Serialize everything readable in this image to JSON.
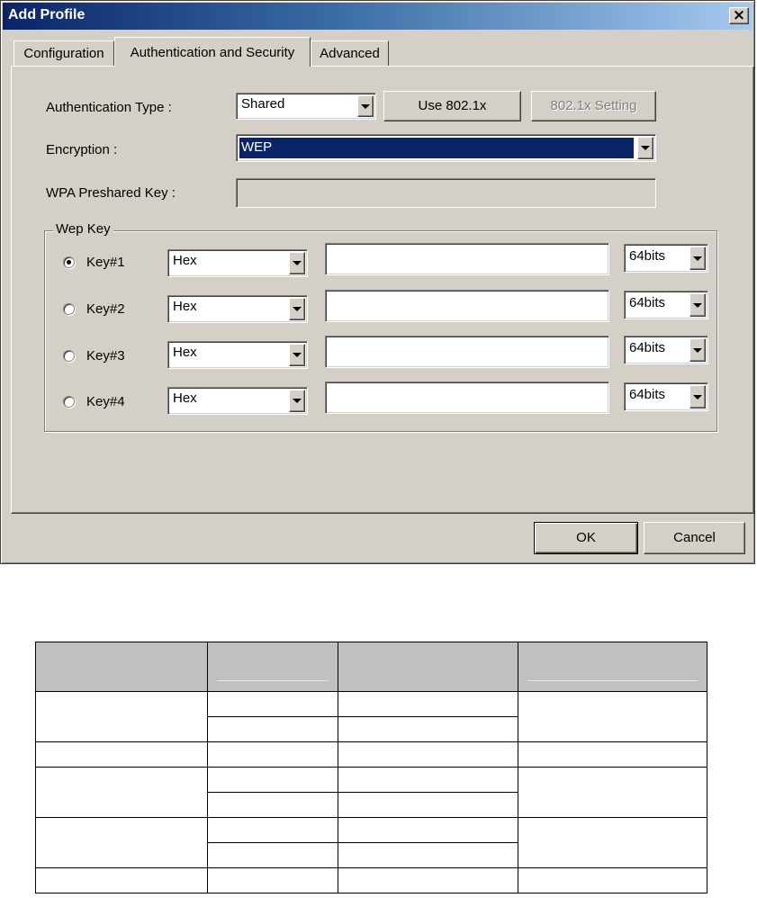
{
  "window": {
    "title": "Add Profile",
    "close_label": "×"
  },
  "tabs": [
    {
      "label": "Configuration",
      "active": false
    },
    {
      "label": "Authentication and Security",
      "active": true
    },
    {
      "label": "Advanced",
      "active": false
    }
  ],
  "auth": {
    "type_label": "Authentication Type :",
    "type_value": "Shared",
    "use_8021x_label": "Use 802.1x",
    "setting_8021x_label": "802.1x Setting",
    "encryption_label": "Encryption :",
    "encryption_value": "WEP",
    "wpa_label": "WPA Preshared Key :",
    "wpa_value": ""
  },
  "wep": {
    "group_label": "Wep Key",
    "keys": [
      {
        "label": "Key#1",
        "selected": true,
        "format": "Hex",
        "value": "",
        "length": "64bits"
      },
      {
        "label": "Key#2",
        "selected": false,
        "format": "Hex",
        "value": "",
        "length": "64bits"
      },
      {
        "label": "Key#3",
        "selected": false,
        "format": "Hex",
        "value": "",
        "length": "64bits"
      },
      {
        "label": "Key#4",
        "selected": false,
        "format": "Hex",
        "value": "",
        "length": "64bits"
      }
    ]
  },
  "footer": {
    "ok_label": "OK",
    "cancel_label": "Cancel"
  },
  "table": {
    "header_fill": "#c0c0c0"
  },
  "colors": {
    "dialog_bg": "#d4d0c8",
    "title_start": "#0a246a",
    "title_end": "#a6caf0",
    "selection": "#0a246a"
  }
}
